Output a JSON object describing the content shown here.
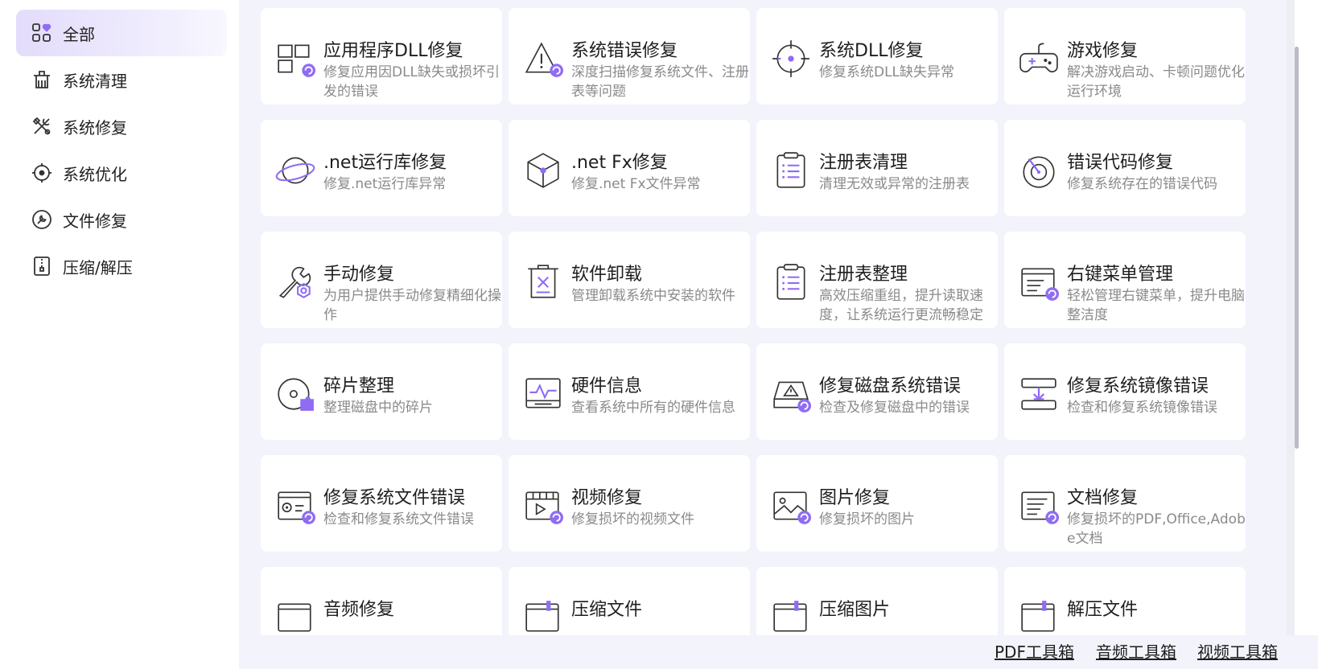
{
  "accent": "#8f6cf2",
  "sidebar": {
    "items": [
      {
        "label": "全部",
        "icon": "grid-heart-icon",
        "active": true
      },
      {
        "label": "系统清理",
        "icon": "broom-icon"
      },
      {
        "label": "系统修复",
        "icon": "wrench-screwdriver-icon"
      },
      {
        "label": "系统优化",
        "icon": "crosshair-icon"
      },
      {
        "label": "文件修复",
        "icon": "file-wrench-icon"
      },
      {
        "label": "压缩/解压",
        "icon": "zip-icon"
      }
    ]
  },
  "cards": [
    {
      "title": "应用程序DLL修复",
      "desc": "修复应用因DLL缺失或损坏引发的错误",
      "icon": "app-dll-repair-icon"
    },
    {
      "title": "系统错误修复",
      "desc": "深度扫描修复系统文件、注册表等问题",
      "icon": "warning-repair-icon"
    },
    {
      "title": "系统DLL修复",
      "desc": "修复系统DLL缺失异常",
      "icon": "target-icon"
    },
    {
      "title": "游戏修复",
      "desc": "解决游戏启动、卡顿问题优化运行环境",
      "icon": "gamepad-icon"
    },
    {
      "title": ".net运行库修复",
      "desc": "修复.net运行库异常",
      "icon": "planet-icon"
    },
    {
      "title": ".net Fx修复",
      "desc": "修复.net Fx文件异常",
      "icon": "cube-icon"
    },
    {
      "title": "注册表清理",
      "desc": "清理无效或异常的注册表",
      "icon": "clipboard-list-icon"
    },
    {
      "title": "错误代码修复",
      "desc": "修复系统存在的错误代码",
      "icon": "gauge-icon"
    },
    {
      "title": "手动修复",
      "desc": "为用户提供手动修复精细化操作",
      "icon": "wrench-hex-icon"
    },
    {
      "title": "软件卸载",
      "desc": "管理卸载系统中安装的软件",
      "icon": "trash-icon"
    },
    {
      "title": "注册表整理",
      "desc": "高效压缩重组，提升读取速度，让系统运行更流畅稳定",
      "icon": "clipboard-list-icon"
    },
    {
      "title": "右键菜单管理",
      "desc": "轻松管理右键菜单，提升电脑整洁度",
      "icon": "menu-window-icon"
    },
    {
      "title": "碎片整理",
      "desc": "整理磁盘中的碎片",
      "icon": "disk-puzzle-icon"
    },
    {
      "title": "硬件信息",
      "desc": "查看系统中所有的硬件信息",
      "icon": "monitor-pulse-icon"
    },
    {
      "title": "修复磁盘系统错误",
      "desc": "检查及修复磁盘中的错误",
      "icon": "disk-warning-icon"
    },
    {
      "title": "修复系统镜像错误",
      "desc": "检查和修复系统镜像错误",
      "icon": "drive-download-icon"
    },
    {
      "title": "修复系统文件错误",
      "desc": "检查和修复系统文件错误",
      "icon": "window-gear-icon"
    },
    {
      "title": "视频修复",
      "desc": "修复损坏的视频文件",
      "icon": "video-icon"
    },
    {
      "title": "图片修复",
      "desc": "修复损坏的图片",
      "icon": "image-icon"
    },
    {
      "title": "文档修复",
      "desc": "修复损坏的PDF,Office,Adobe文档",
      "icon": "document-icon"
    },
    {
      "title": "音频修复",
      "desc": "",
      "icon": "audio-icon"
    },
    {
      "title": "压缩文件",
      "desc": "",
      "icon": "compress-file-icon"
    },
    {
      "title": "压缩图片",
      "desc": "",
      "icon": "compress-image-icon"
    },
    {
      "title": "解压文件",
      "desc": "",
      "icon": "extract-file-icon"
    }
  ],
  "footer": {
    "links": [
      "PDF工具箱",
      "音频工具箱",
      "视频工具箱"
    ]
  }
}
